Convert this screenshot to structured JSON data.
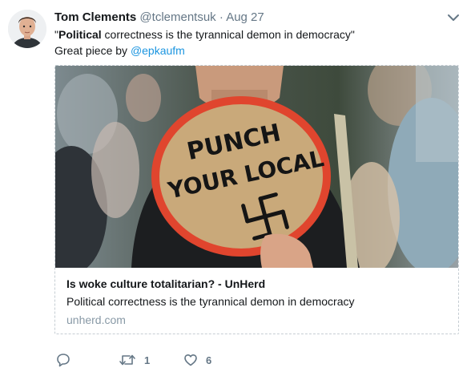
{
  "tweet": {
    "author_name": "Tom Clements",
    "handle": "@tclementsuk",
    "separator": "·",
    "date": "Aug 27",
    "text_quote_open": "\"",
    "text_bold": "Political",
    "text_rest": " correctness is the tyrannical demon in democracy\"",
    "line2_prefix": "Great piece by ",
    "mention": "@epkaufm"
  },
  "card": {
    "image_sign_line1": "PUNCH",
    "image_sign_line2": "YOUR LOCAL",
    "title": "Is woke culture totalitarian? - UnHerd",
    "description": "Political correctness is the tyrannical demon in democracy",
    "domain": "unherd.com"
  },
  "actions": {
    "reply_icon": "reply-icon",
    "retweet_icon": "retweet-icon",
    "retweet_count": "1",
    "like_icon": "heart-icon",
    "like_count": "6"
  },
  "colors": {
    "link": "#1b95e0",
    "secondary_text": "#657786",
    "card_border": "#c5cdd3",
    "sign_red": "#e0452e",
    "sign_cardboard": "#c9a97a"
  }
}
